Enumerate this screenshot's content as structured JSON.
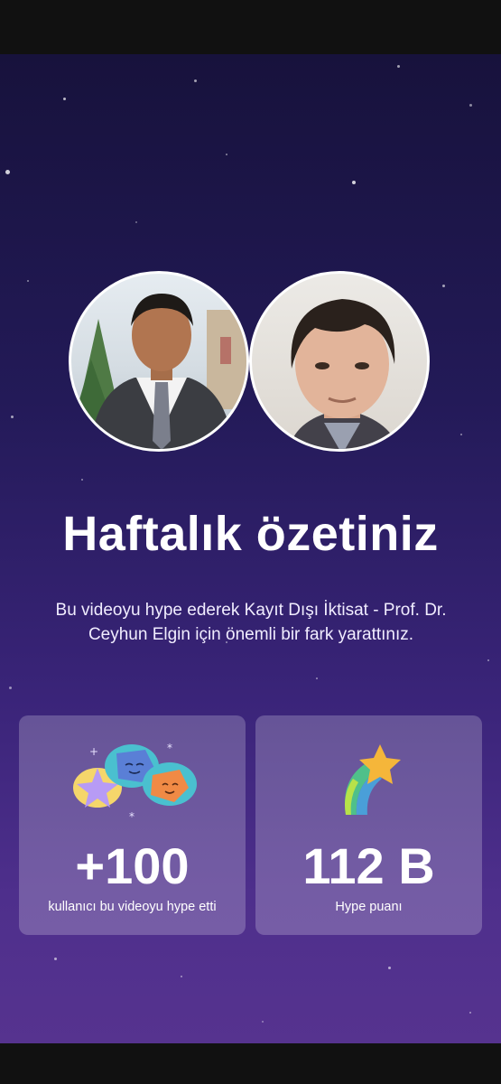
{
  "summary": {
    "title": "Haftalık özetiniz",
    "description": "Bu videoyu hype ederek Kayıt Dışı İktisat - Prof. Dr. Ceyhun Elgin için önemli bir fark yarattınız."
  },
  "stats": [
    {
      "value": "+100",
      "label": "kullanıcı bu videoyu hype etti",
      "icon": "hype-users-icon"
    },
    {
      "value": "112 B",
      "label": "Hype puanı",
      "icon": "shooting-star-icon"
    }
  ],
  "colors": {
    "background_top": "#17123c",
    "background_bottom": "#56338f",
    "text": "#ffffff",
    "star_yellow": "#f5c84a",
    "badge_teal": "#4ac0cf",
    "badge_orange": "#f08a45",
    "badge_purple": "#b79bf5"
  }
}
